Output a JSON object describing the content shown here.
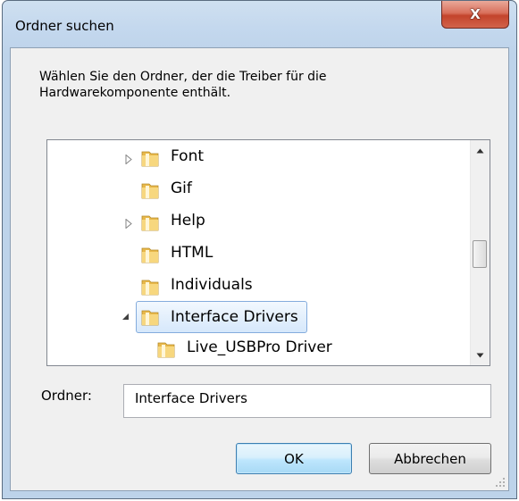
{
  "window": {
    "title": "Ordner suchen",
    "close_glyph": "X"
  },
  "instruction": "Wählen Sie den Ordner, der die Treiber für die Hardwarekomponente enthält.",
  "tree": {
    "items": [
      {
        "label": "Font",
        "expander": "collapsed"
      },
      {
        "label": "Gif",
        "expander": "none"
      },
      {
        "label": "Help",
        "expander": "collapsed"
      },
      {
        "label": "HTML",
        "expander": "none"
      },
      {
        "label": "Individuals",
        "expander": "none"
      },
      {
        "label": "Interface Drivers",
        "expander": "expanded",
        "selected": true
      },
      {
        "label": "Live_USBPro Driver",
        "expander": "none"
      }
    ]
  },
  "folder_field": {
    "label": "Ordner:",
    "value": "Interface Drivers"
  },
  "buttons": {
    "ok": "OK",
    "cancel": "Abbrechen"
  },
  "icons": {
    "folder": "folder-icon",
    "expander_collapsed": "triangle-right-icon",
    "expander_expanded": "triangle-down-icon"
  },
  "colors": {
    "selection_border": "#84acdd",
    "close_button": "#c3442c",
    "default_button_border": "#3c7fb1"
  }
}
